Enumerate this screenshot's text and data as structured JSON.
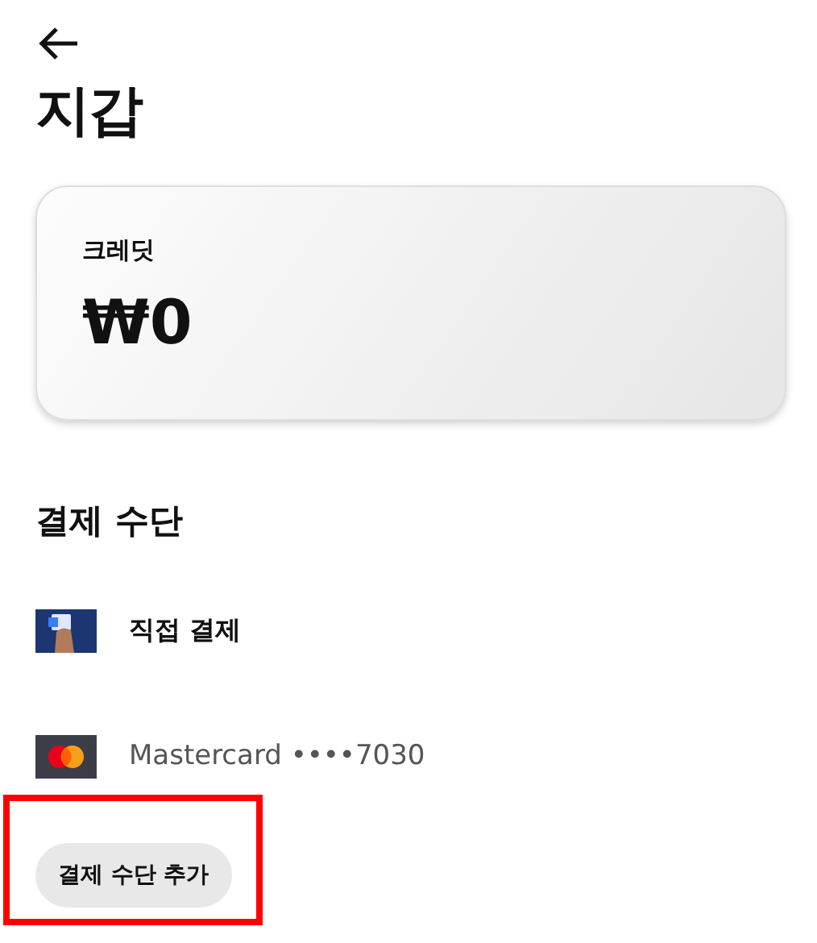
{
  "header": {
    "title": "지갑"
  },
  "credit_card": {
    "label": "크레딧",
    "amount": "₩0"
  },
  "payment_section": {
    "title": "결제 수단",
    "methods": [
      {
        "kind": "cash",
        "label": "직접 결제"
      },
      {
        "kind": "mastercard",
        "label": "Mastercard ••••7030"
      }
    ]
  },
  "add_button": {
    "label": "결제 수단 추가",
    "highlighted": true
  }
}
